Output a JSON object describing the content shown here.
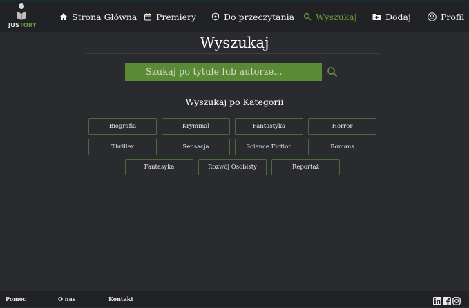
{
  "nav": {
    "logo_text_main": "JUS",
    "logo_text_accent": "TORY",
    "items": [
      {
        "label": "Strona Główna",
        "icon": "home-icon"
      },
      {
        "label": "Premiery",
        "icon": "calendar-icon"
      },
      {
        "label": "Do przeczytania",
        "icon": "shield-icon"
      },
      {
        "label": "Wyszukaj",
        "icon": "search-icon",
        "active": true
      },
      {
        "label": "Dodaj",
        "icon": "folder-plus-icon"
      },
      {
        "label": "Profil",
        "icon": "user-icon"
      }
    ]
  },
  "main": {
    "title": "Wyszukaj",
    "search_placeholder": "Szukaj po tytule lub autorze...",
    "categories_title": "Wyszukaj po Kategorii",
    "categories": [
      "Biografia",
      "Kryminał",
      "Fantastyka",
      "Horror",
      "Thriller",
      "Sensacja",
      "Science Fiction",
      "Romans",
      "Fantasyka",
      "Rozwój Osobisty",
      "Reportaż"
    ]
  },
  "footer": {
    "links": [
      "Pomoc",
      "O nas",
      "Kontakt"
    ],
    "social": [
      "linkedin-icon",
      "facebook-icon",
      "instagram-icon"
    ]
  },
  "colors": {
    "background": "#2a2b2f",
    "navbar": "#212226",
    "accent_green": "#6b9a3c",
    "search_bg": "#5a8a35"
  }
}
